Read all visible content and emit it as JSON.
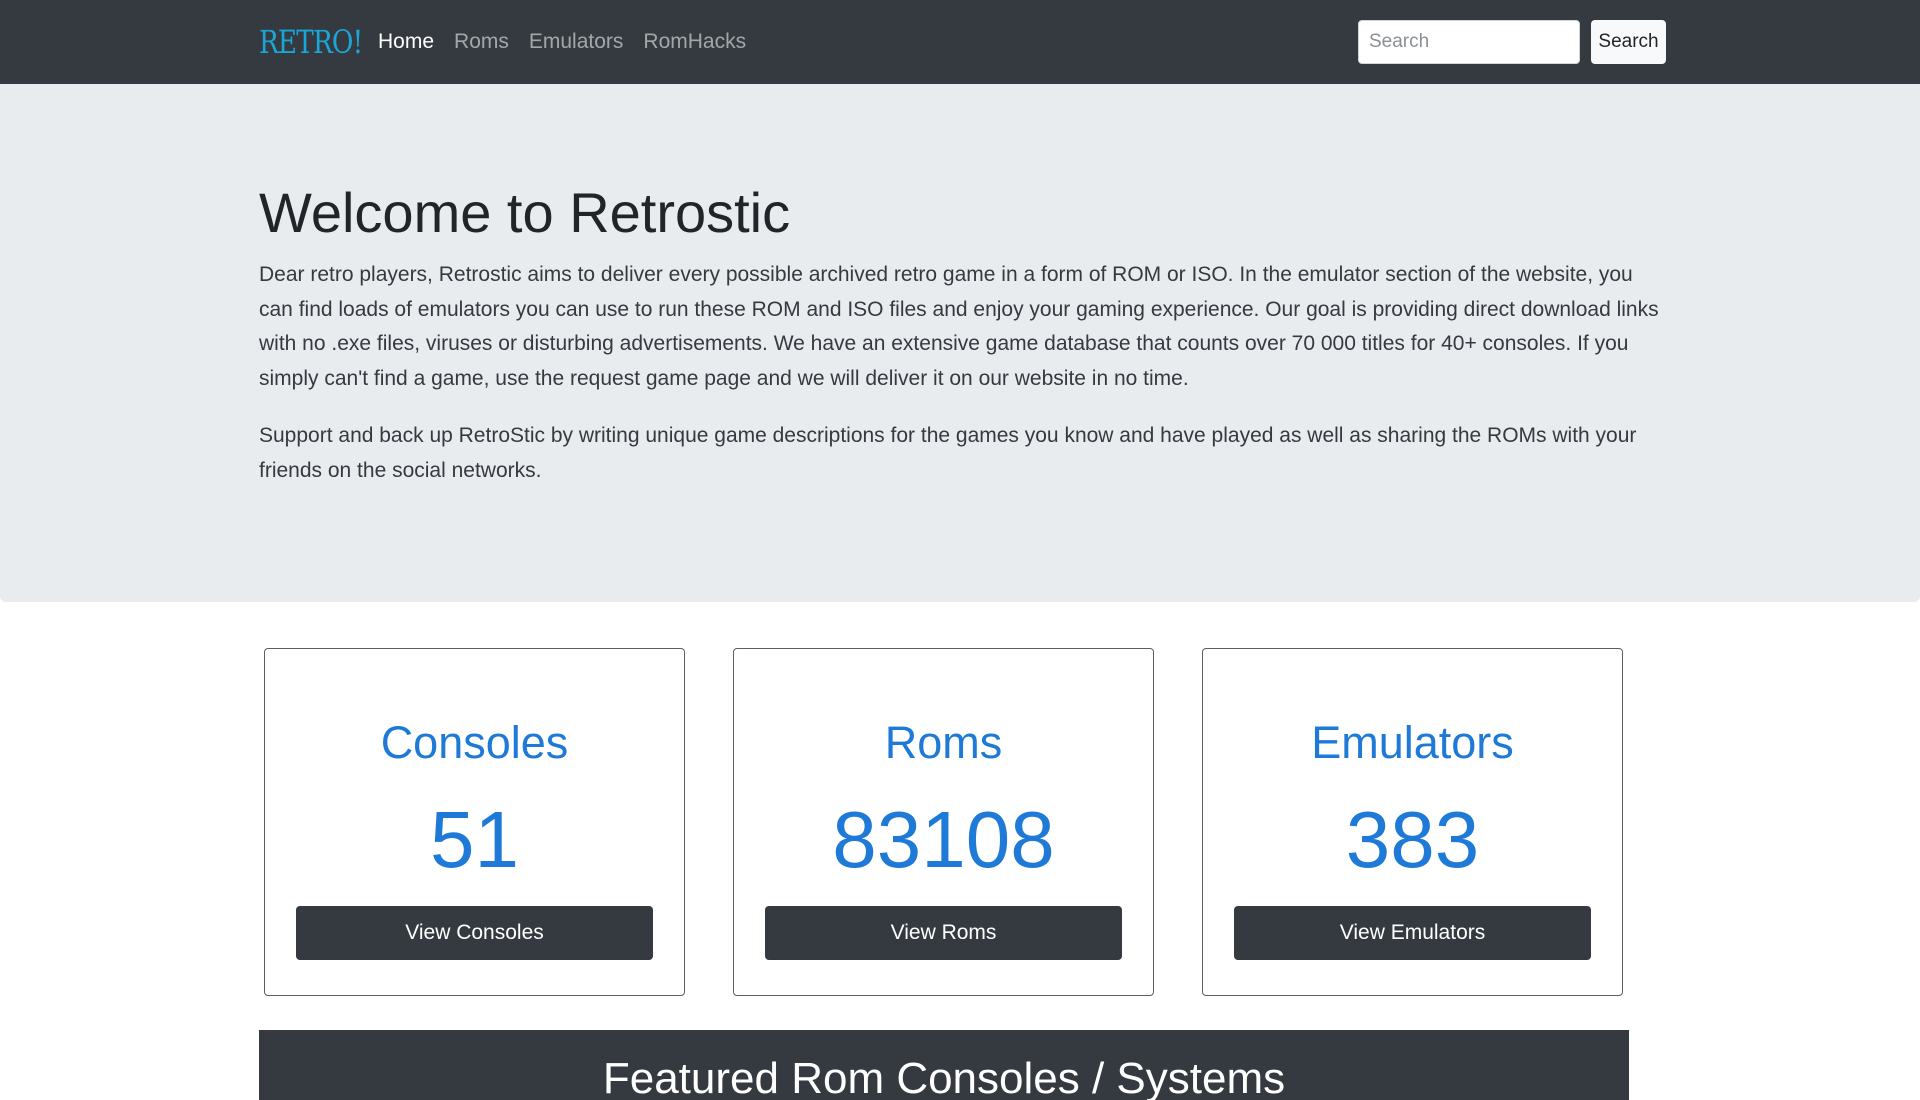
{
  "navbar": {
    "brand": "RETRO!",
    "links": [
      {
        "label": "Home",
        "active": true
      },
      {
        "label": "Roms",
        "active": false
      },
      {
        "label": "Emulators",
        "active": false
      },
      {
        "label": "RomHacks",
        "active": false
      }
    ],
    "search": {
      "placeholder": "Search",
      "value": "",
      "button_label": "Search"
    }
  },
  "hero": {
    "title": "Welcome to Retrostic",
    "paragraphs": [
      "Dear retro players, Retrostic aims to deliver every possible archived retro game in a form of ROM or ISO. In the emulator section of the website, you can find loads of emulators you can use to run these ROM and ISO files and enjoy your gaming experience. Our goal is providing direct download links with no .exe files, viruses or disturbing advertisements. We have an extensive game database that counts over 70 000 titles for 40+ consoles. If you simply can't find a game, use the request game page and we will deliver it on our website in no time.",
      "Support and back up RetroStic by writing unique game descriptions for the games you know and have played as well as sharing the ROMs with your friends on the social networks."
    ]
  },
  "stats": [
    {
      "title": "Consoles",
      "count": "51",
      "button_label": "View Consoles"
    },
    {
      "title": "Roms",
      "count": "83108",
      "button_label": "View Roms"
    },
    {
      "title": "Emulators",
      "count": "383",
      "button_label": "View Emulators"
    }
  ],
  "featured": {
    "title": "Featured Rom Consoles / Systems"
  },
  "colors": {
    "navbar_bg": "#343a40",
    "brand": "#1aa6d8",
    "jumbotron_bg": "#e9ecef",
    "stat_accent": "#1e7ad6",
    "button_dark": "#343a40"
  }
}
